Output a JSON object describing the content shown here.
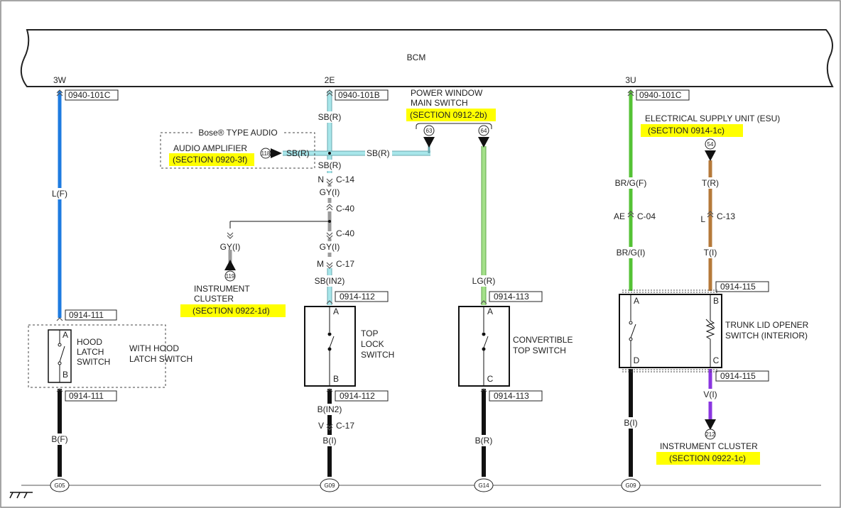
{
  "module": {
    "name": "BCM",
    "pins": [
      "3W",
      "2E",
      "3U"
    ]
  },
  "colors": {
    "blue_wire": "#1e7be0",
    "light_blue_wire": "#a8e6ea",
    "gray_wire": "#9a9a9a",
    "green_wire": "#55c235",
    "light_green_wire": "#a4e08a",
    "brown_wire": "#b5793a",
    "purple_wire": "#8a36e0",
    "black_wire": "#111111",
    "highlight": "#ffff00"
  },
  "connectors": {
    "c1": "0940-101C",
    "c2": "0940-101B",
    "c3": "0940-101C",
    "hood_top": "0914-111",
    "hood_bottom": "0914-111",
    "top_lock_top": "0914-112",
    "top_lock_bottom": "0914-112",
    "conv_top": "0914-113",
    "conv_bottom": "0914-113",
    "trunk_top": "0914-115",
    "trunk_bottom": "0914-115"
  },
  "wire_labels": {
    "lf": "L(F)",
    "sbr1": "SB(R)",
    "sbr_amp": "SB(R)",
    "sbr_pw": "SB(R)",
    "sbr2": "SB(R)",
    "gyi1": "GY(I)",
    "gyi2": "GY(I)",
    "gyi_left": "GY(I)",
    "sbin2": "SB(IN2)",
    "bin2": "B(IN2)",
    "bi_mid": "B(I)",
    "bf": "B(F)",
    "lgr": "LG(R)",
    "br": "B(R)",
    "brgf": "BR/G(F)",
    "brgi": "BR/G(I)",
    "bi_right": "B(I)",
    "tr": "T(R)",
    "ti": "T(I)",
    "vi": "V(I)"
  },
  "splices": {
    "c14_letter": "N",
    "c14": "C-14",
    "c40a": "C-40",
    "c40b": "C-40",
    "c17a_letter": "M",
    "c17a": "C-17",
    "c17b_letter": "V",
    "c17b": "C-17",
    "c04_letter": "AE",
    "c04": "C-04",
    "c13_letter": "L",
    "c13": "C-13"
  },
  "bose_group": {
    "title": "Bose® TYPE AUDIO",
    "name": "AUDIO AMPLIFIER",
    "section": "(SECTION 0920-3f)",
    "ref": "118"
  },
  "power_window": {
    "line1": "POWER WINDOW",
    "line2": "MAIN SWITCH",
    "section": "(SECTION 0912-2b)",
    "ref_a": "63",
    "ref_b": "64"
  },
  "esu": {
    "name": "ELECTRICAL SUPPLY UNIT (ESU)",
    "section": "(SECTION 0914-1c)",
    "ref": "54"
  },
  "instrument_cluster_left": {
    "line1": "INSTRUMENT",
    "line2": "CLUSTER",
    "section": "(SECTION 0922-1d)",
    "ref": "119"
  },
  "instrument_cluster_right": {
    "name": "INSTRUMENT CLUSTER",
    "section": "(SECTION 0922-1c)",
    "ref": "212"
  },
  "switches": {
    "hood": {
      "lines": [
        "HOOD",
        "LATCH",
        "SWITCH"
      ],
      "pin_top": "A",
      "pin_bottom": "B",
      "option_line1": "WITH HOOD",
      "option_line2": "LATCH SWITCH"
    },
    "top_lock": {
      "lines": [
        "TOP",
        "LOCK",
        "SWITCH"
      ],
      "pin_top": "A",
      "pin_bottom": "B"
    },
    "convertible": {
      "line1": "CONVERTIBLE",
      "line2": "TOP SWITCH",
      "pin_top": "A",
      "pin_bottom": "C"
    },
    "trunk": {
      "line1": "TRUNK LID OPENER",
      "line2": "SWITCH (INTERIOR)",
      "pins": [
        "A",
        "B",
        "D",
        "C"
      ]
    }
  },
  "grounds": [
    "G05",
    "G09",
    "G14",
    "G09"
  ]
}
